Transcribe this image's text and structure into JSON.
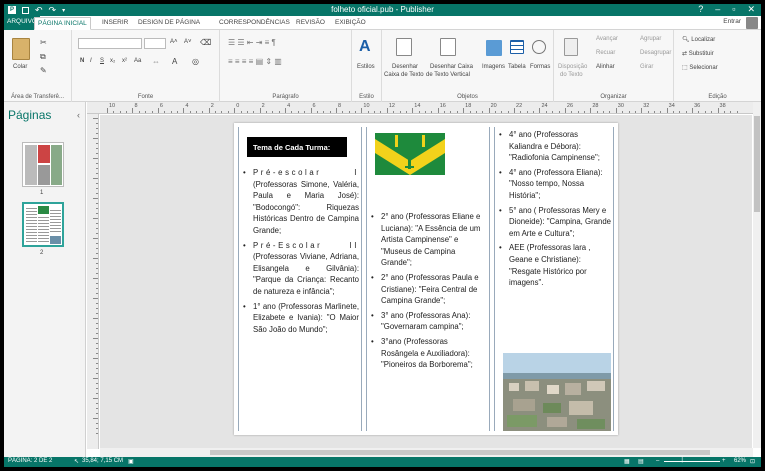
{
  "window": {
    "title": "folheto oficial.pub - Publisher",
    "help": "?",
    "minimize": "–",
    "restore": "▫",
    "close": "✕"
  },
  "tabs": [
    "ARQUIVO",
    "PÁGINA INICIAL",
    "INSERIR",
    "DESIGN DE PÁGINA",
    "CORRESPONDÊNCIAS",
    "REVISÃO",
    "EXIBIÇÃO"
  ],
  "active_tab": "PÁGINA INICIAL",
  "account": {
    "signin": "Entrar"
  },
  "ribbon": {
    "clipboard": {
      "label": "Área de Transferê...",
      "paste": "Colar"
    },
    "font": {
      "label": "Fonte",
      "bold": "N",
      "italic": "I",
      "underline": "S",
      "sub": "x₂",
      "sup": "x²",
      "aa": "Aa",
      "grow": "A˄",
      "shrink": "A˅"
    },
    "paragraph": {
      "label": "Parágrafo"
    },
    "styles": {
      "label": "Estilo",
      "button": "Estilos"
    },
    "objects": {
      "label": "Objetos",
      "draw_textbox_line1": "Desenhar",
      "draw_textbox_line2": "Caixa de Texto",
      "draw_vertical_line1": "Desenhar Caixa",
      "draw_vertical_line2": "de Texto Vertical",
      "images": "Imagens",
      "table": "Tabela",
      "shapes": "Formas"
    },
    "arrange": {
      "label": "Organizar",
      "wrap_line1": "Disposição",
      "wrap_line2": "do Texto",
      "bring_forward": "Avançar",
      "send_backward": "Recuar",
      "align": "Alinhar",
      "group": "Agrupar",
      "ungroup": "Desagrupar",
      "rotate": "Girar"
    },
    "editing": {
      "label": "Edição",
      "find": "Localizar",
      "replace": "Substituir",
      "select": "Selecionar"
    }
  },
  "pages_pane": {
    "title": "Páginas",
    "pages": [
      "1",
      "2"
    ],
    "selected": "2"
  },
  "ruler": {
    "numbers": [
      "10",
      "8",
      "6",
      "4",
      "2",
      "0",
      "2",
      "4",
      "6",
      "8",
      "10",
      "12",
      "14",
      "16",
      "18",
      "20",
      "22",
      "24",
      "26",
      "28",
      "30",
      "32",
      "34",
      "36",
      "38"
    ]
  },
  "document": {
    "theme_heading": "Tema de Cada Turma:",
    "col1": [
      {
        "lead": "Pré-escolar I",
        "rest": "(Professoras Simone, Valéria, Paula e Maria José): \"Bodocongó\": Riquezas Históricas Dentro de Campina Grande;"
      },
      {
        "lead": "Pré-Escolar II",
        "rest": "(Professoras Viviane, Adriana, Elisangela e Gilvânia): \"Parque da Criança: Recanto de natureza e infância\";"
      },
      {
        "lead": "",
        "rest": "1° ano (Professoras Marlinete, Elizabete e Ivania): \"O Maior São João do Mundo\";"
      }
    ],
    "col2": [
      "2° ano (Professoras Eliane e Luciana): \"A Essência de um Artista Campinense\" e \"Museus de Campina Grande\";",
      "2° ano (Professoras Paula e Cristiane): \"Feira Central de Campina Grande\";",
      "3° ano (Professoras Ana): \"Governaram campina\";",
      "3°ano (Professoras Rosângela e Auxiliadora): \"Pioneiros da Borborema\";"
    ],
    "col3": [
      "4° ano (Professoras Kaliandra e Débora): \"Radiofonia Campinense\";",
      "4° ano (Professora Eliana): \"Nosso tempo, Nossa História\";",
      "5° ano ( Professoras Mery e Dioneide): \"Campina, Grande em Arte e Cultura\";",
      "AEE (Professoras lara , Geane e Christiane): \"Resgate Histórico por imagens\"."
    ]
  },
  "status": {
    "page": "PÁGINA: 2 DE 2",
    "position": "35,84; 7,15 CM",
    "zoom": "62%",
    "zoom_fraction": 0.62
  },
  "colors": {
    "accent": "#077568",
    "flag_green": "#1e8a3c",
    "flag_yellow": "#f2d21b"
  },
  "icons": [
    "save-icon",
    "undo-icon",
    "redo-icon",
    "paste-icon",
    "cut-icon",
    "copy-icon",
    "format-painter-icon",
    "styles-icon",
    "textbox-icon",
    "vertical-textbox-icon",
    "images-icon",
    "table-icon",
    "shapes-icon",
    "wrap-text-icon",
    "find-icon",
    "replace-icon",
    "select-icon",
    "page-status-icon",
    "cursor-position-icon",
    "view-normal-icon",
    "view-master-icon",
    "zoom-out-icon",
    "zoom-in-icon",
    "fit-page-icon"
  ]
}
